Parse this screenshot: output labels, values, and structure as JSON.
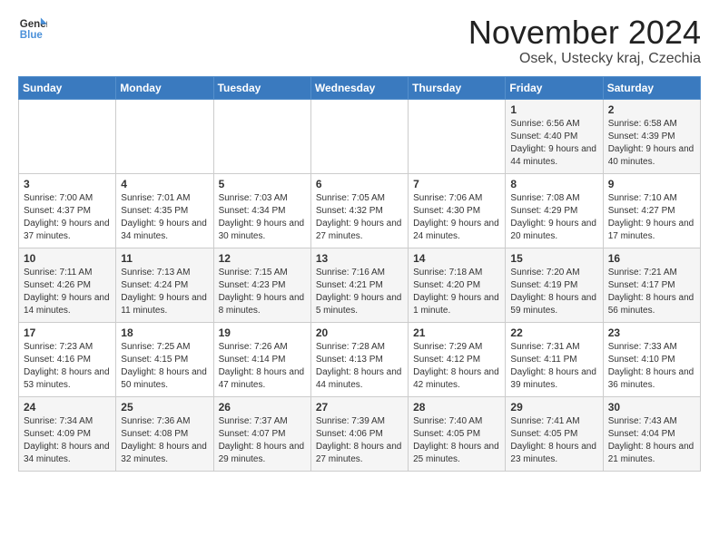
{
  "logo": {
    "line1": "General",
    "line2": "Blue"
  },
  "title": "November 2024",
  "location": "Osek, Ustecky kraj, Czechia",
  "header": {
    "days": [
      "Sunday",
      "Monday",
      "Tuesday",
      "Wednesday",
      "Thursday",
      "Friday",
      "Saturday"
    ]
  },
  "weeks": [
    {
      "cells": [
        {
          "day": "",
          "content": ""
        },
        {
          "day": "",
          "content": ""
        },
        {
          "day": "",
          "content": ""
        },
        {
          "day": "",
          "content": ""
        },
        {
          "day": "",
          "content": ""
        },
        {
          "day": "1",
          "content": "Sunrise: 6:56 AM\nSunset: 4:40 PM\nDaylight: 9 hours and 44 minutes."
        },
        {
          "day": "2",
          "content": "Sunrise: 6:58 AM\nSunset: 4:39 PM\nDaylight: 9 hours and 40 minutes."
        }
      ]
    },
    {
      "cells": [
        {
          "day": "3",
          "content": "Sunrise: 7:00 AM\nSunset: 4:37 PM\nDaylight: 9 hours and 37 minutes."
        },
        {
          "day": "4",
          "content": "Sunrise: 7:01 AM\nSunset: 4:35 PM\nDaylight: 9 hours and 34 minutes."
        },
        {
          "day": "5",
          "content": "Sunrise: 7:03 AM\nSunset: 4:34 PM\nDaylight: 9 hours and 30 minutes."
        },
        {
          "day": "6",
          "content": "Sunrise: 7:05 AM\nSunset: 4:32 PM\nDaylight: 9 hours and 27 minutes."
        },
        {
          "day": "7",
          "content": "Sunrise: 7:06 AM\nSunset: 4:30 PM\nDaylight: 9 hours and 24 minutes."
        },
        {
          "day": "8",
          "content": "Sunrise: 7:08 AM\nSunset: 4:29 PM\nDaylight: 9 hours and 20 minutes."
        },
        {
          "day": "9",
          "content": "Sunrise: 7:10 AM\nSunset: 4:27 PM\nDaylight: 9 hours and 17 minutes."
        }
      ]
    },
    {
      "cells": [
        {
          "day": "10",
          "content": "Sunrise: 7:11 AM\nSunset: 4:26 PM\nDaylight: 9 hours and 14 minutes."
        },
        {
          "day": "11",
          "content": "Sunrise: 7:13 AM\nSunset: 4:24 PM\nDaylight: 9 hours and 11 minutes."
        },
        {
          "day": "12",
          "content": "Sunrise: 7:15 AM\nSunset: 4:23 PM\nDaylight: 9 hours and 8 minutes."
        },
        {
          "day": "13",
          "content": "Sunrise: 7:16 AM\nSunset: 4:21 PM\nDaylight: 9 hours and 5 minutes."
        },
        {
          "day": "14",
          "content": "Sunrise: 7:18 AM\nSunset: 4:20 PM\nDaylight: 9 hours and 1 minute."
        },
        {
          "day": "15",
          "content": "Sunrise: 7:20 AM\nSunset: 4:19 PM\nDaylight: 8 hours and 59 minutes."
        },
        {
          "day": "16",
          "content": "Sunrise: 7:21 AM\nSunset: 4:17 PM\nDaylight: 8 hours and 56 minutes."
        }
      ]
    },
    {
      "cells": [
        {
          "day": "17",
          "content": "Sunrise: 7:23 AM\nSunset: 4:16 PM\nDaylight: 8 hours and 53 minutes."
        },
        {
          "day": "18",
          "content": "Sunrise: 7:25 AM\nSunset: 4:15 PM\nDaylight: 8 hours and 50 minutes."
        },
        {
          "day": "19",
          "content": "Sunrise: 7:26 AM\nSunset: 4:14 PM\nDaylight: 8 hours and 47 minutes."
        },
        {
          "day": "20",
          "content": "Sunrise: 7:28 AM\nSunset: 4:13 PM\nDaylight: 8 hours and 44 minutes."
        },
        {
          "day": "21",
          "content": "Sunrise: 7:29 AM\nSunset: 4:12 PM\nDaylight: 8 hours and 42 minutes."
        },
        {
          "day": "22",
          "content": "Sunrise: 7:31 AM\nSunset: 4:11 PM\nDaylight: 8 hours and 39 minutes."
        },
        {
          "day": "23",
          "content": "Sunrise: 7:33 AM\nSunset: 4:10 PM\nDaylight: 8 hours and 36 minutes."
        }
      ]
    },
    {
      "cells": [
        {
          "day": "24",
          "content": "Sunrise: 7:34 AM\nSunset: 4:09 PM\nDaylight: 8 hours and 34 minutes."
        },
        {
          "day": "25",
          "content": "Sunrise: 7:36 AM\nSunset: 4:08 PM\nDaylight: 8 hours and 32 minutes."
        },
        {
          "day": "26",
          "content": "Sunrise: 7:37 AM\nSunset: 4:07 PM\nDaylight: 8 hours and 29 minutes."
        },
        {
          "day": "27",
          "content": "Sunrise: 7:39 AM\nSunset: 4:06 PM\nDaylight: 8 hours and 27 minutes."
        },
        {
          "day": "28",
          "content": "Sunrise: 7:40 AM\nSunset: 4:05 PM\nDaylight: 8 hours and 25 minutes."
        },
        {
          "day": "29",
          "content": "Sunrise: 7:41 AM\nSunset: 4:05 PM\nDaylight: 8 hours and 23 minutes."
        },
        {
          "day": "30",
          "content": "Sunrise: 7:43 AM\nSunset: 4:04 PM\nDaylight: 8 hours and 21 minutes."
        }
      ]
    }
  ]
}
